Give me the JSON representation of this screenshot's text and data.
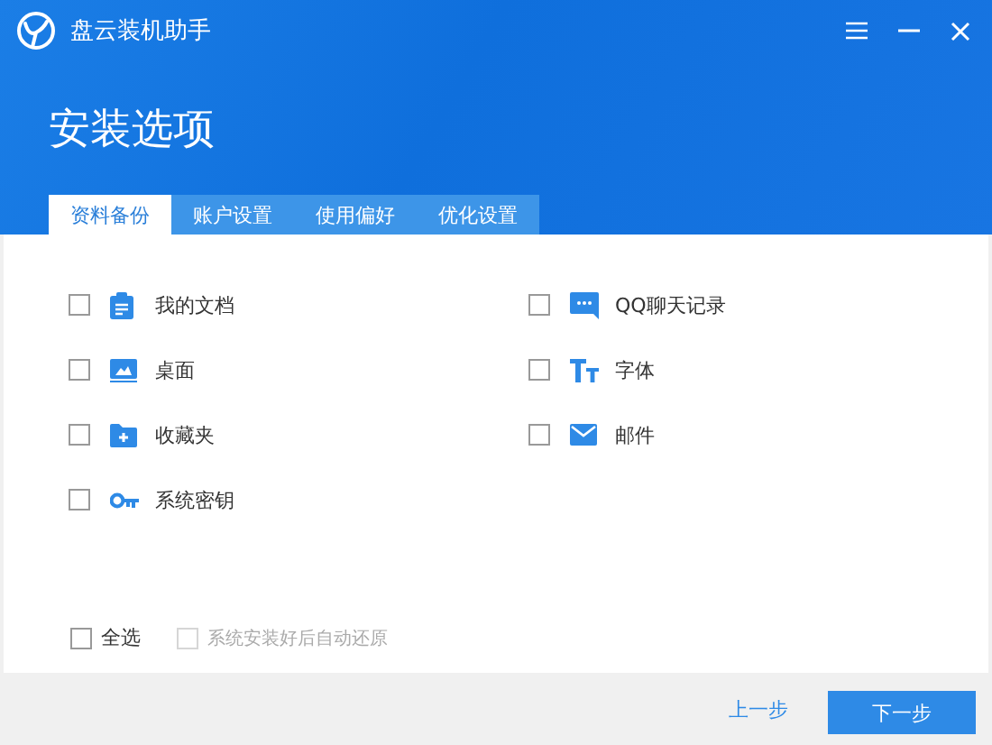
{
  "window": {
    "title": "盘云装机助手"
  },
  "heading": "安装选项",
  "tabs": [
    {
      "label": "资料备份",
      "selected": true
    },
    {
      "label": "账户设置",
      "selected": false
    },
    {
      "label": "使用偏好",
      "selected": false
    },
    {
      "label": "优化设置",
      "selected": false
    }
  ],
  "options": [
    {
      "label": "我的文档",
      "checked": false
    },
    {
      "label": "QQ聊天记录",
      "checked": false
    },
    {
      "label": "桌面",
      "checked": false
    },
    {
      "label": "字体",
      "checked": false
    },
    {
      "label": "收藏夹",
      "checked": false
    },
    {
      "label": "邮件",
      "checked": false
    },
    {
      "label": "系统密钥",
      "checked": false
    }
  ],
  "select_all": {
    "label": "全选",
    "checked": false
  },
  "auto_restore": {
    "label": "系统安装好后自动还原",
    "checked": false,
    "disabled": true
  },
  "buttons": {
    "back": "上一步",
    "next": "下一步"
  }
}
